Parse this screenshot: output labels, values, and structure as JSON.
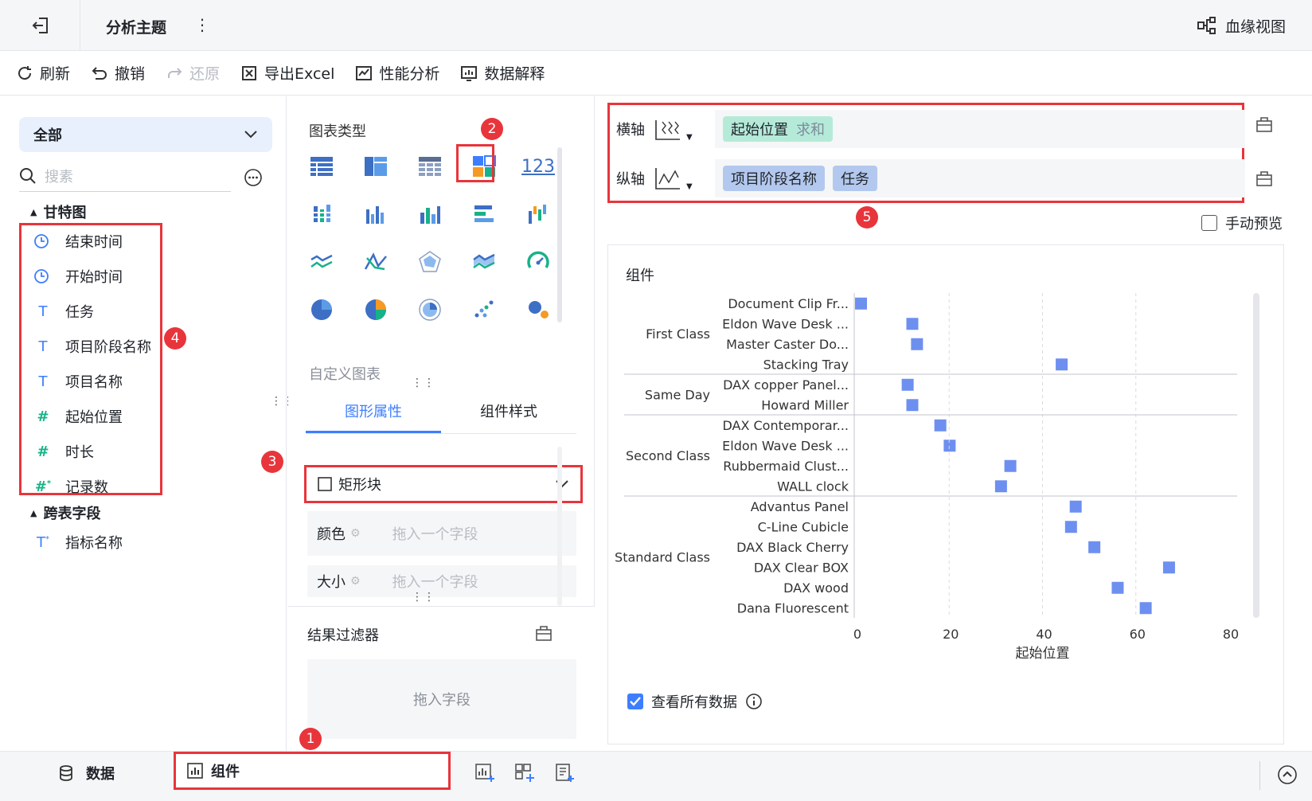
{
  "titlebar": {
    "title": "分析主题",
    "more": "⋮",
    "lineage_label": "血缘视图"
  },
  "toolbar": {
    "refresh": "刷新",
    "undo": "撤销",
    "redo": "还原",
    "export_excel": "导出Excel",
    "perf_analysis": "性能分析",
    "data_explain": "数据解释"
  },
  "left": {
    "scope": "全部",
    "search_placeholder": "搜素",
    "groups": [
      {
        "name": "甘特图",
        "fields": [
          {
            "label": "结束时间",
            "type": "time"
          },
          {
            "label": "开始时间",
            "type": "time"
          },
          {
            "label": "任务",
            "type": "text"
          },
          {
            "label": "项目阶段名称",
            "type": "text"
          },
          {
            "label": "项目名称",
            "type": "text"
          },
          {
            "label": "起始位置",
            "type": "number"
          },
          {
            "label": "时长",
            "type": "number"
          },
          {
            "label": "记录数",
            "type": "calc-number"
          }
        ]
      },
      {
        "name": "跨表字段",
        "fields": [
          {
            "label": "指标名称",
            "type": "calc-text"
          }
        ]
      }
    ]
  },
  "middle": {
    "chart_type_label": "图表类型",
    "custom_chart": "自定义图表",
    "tabs": [
      "图形属性",
      "组件样式"
    ],
    "mark_type": "矩形块",
    "color_label": "颜色",
    "size_label": "大小",
    "drop_placeholder": "拖入一个字段",
    "filter_title": "结果过滤器",
    "filter_placeholder": "拖入字段"
  },
  "right": {
    "x_axis_label": "横轴",
    "y_axis_label": "纵轴",
    "x_field": "起始位置",
    "x_agg": "求和",
    "y_fields": [
      "项目阶段名称",
      "任务"
    ],
    "manual_preview": "手动预览",
    "view_all": "查看所有数据"
  },
  "bottom": {
    "data_tab": "数据",
    "component_tab": "组件"
  },
  "badges": [
    "1",
    "2",
    "3",
    "4",
    "5"
  ],
  "colors": {
    "accent": "#3d7eff",
    "highlight": "#e8353b",
    "mark": "#6d8ff0"
  },
  "chart_data": {
    "type": "scatter",
    "title": "组件",
    "xlabel": "起始位置",
    "xlim": [
      0,
      80
    ],
    "xticks": [
      0,
      20,
      40,
      60,
      80
    ],
    "groups": [
      {
        "name": "First Class",
        "items": [
          {
            "label": "Document Clip Fr...",
            "x": 0
          },
          {
            "label": "Eldon Wave Desk ...",
            "x": 11
          },
          {
            "label": "Master Caster Do...",
            "x": 12
          },
          {
            "label": "Stacking Tray",
            "x": 43
          }
        ]
      },
      {
        "name": "Same Day",
        "items": [
          {
            "label": "DAX copper Panel...",
            "x": 10
          },
          {
            "label": "Howard Miller",
            "x": 11
          }
        ]
      },
      {
        "name": "Second Class",
        "items": [
          {
            "label": "DAX Contemporar...",
            "x": 17
          },
          {
            "label": "Eldon Wave Desk ...",
            "x": 19
          },
          {
            "label": "Rubbermaid Clust...",
            "x": 32
          },
          {
            "label": "WALL clock",
            "x": 30
          }
        ]
      },
      {
        "name": "Standard Class",
        "items": [
          {
            "label": "Advantus Panel",
            "x": 46
          },
          {
            "label": "C-Line Cubicle",
            "x": 45
          },
          {
            "label": "DAX Black Cherry",
            "x": 50
          },
          {
            "label": "DAX Clear BOX",
            "x": 66
          },
          {
            "label": "DAX wood",
            "x": 55
          },
          {
            "label": "Dana Fluorescent",
            "x": 61
          }
        ]
      }
    ]
  }
}
